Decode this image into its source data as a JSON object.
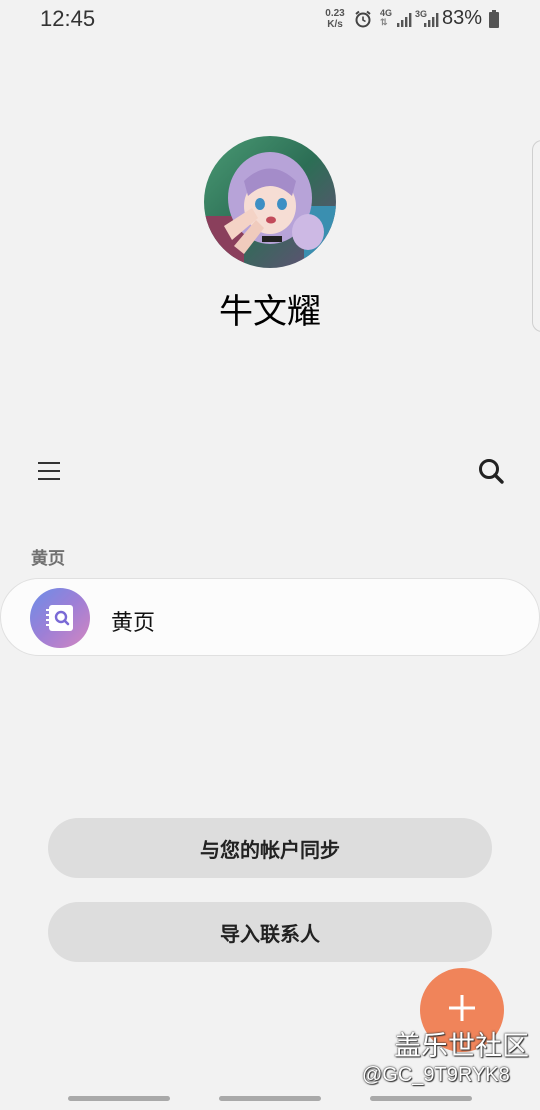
{
  "status_bar": {
    "time": "12:45",
    "net_speed_value": "0.23",
    "net_speed_unit": "K/s",
    "network_4g": "4G",
    "network_3g": "3G",
    "battery_percent": "83%",
    "icons": [
      "alarm-icon",
      "data-arrows-icon",
      "signal-icon",
      "battery-icon"
    ]
  },
  "profile": {
    "name": "牛文耀",
    "avatar_icon": "profile-avatar"
  },
  "toolbar": {
    "menu_icon": "menu-icon",
    "search_icon": "search-icon"
  },
  "section": {
    "header": "黄页",
    "items": [
      {
        "label": "黄页",
        "icon": "yellow-pages-icon"
      }
    ]
  },
  "actions": {
    "sync_label": "与您的帐户同步",
    "import_label": "导入联系人"
  },
  "fab": {
    "icon": "plus-icon",
    "color": "#f0845a"
  },
  "watermark": {
    "line1": "盖乐世社区",
    "line2": "@GC_9T9RYK8"
  },
  "colors": {
    "background": "#f2f2f2",
    "accent": "#f0845a",
    "button_bg": "#dddddd"
  }
}
